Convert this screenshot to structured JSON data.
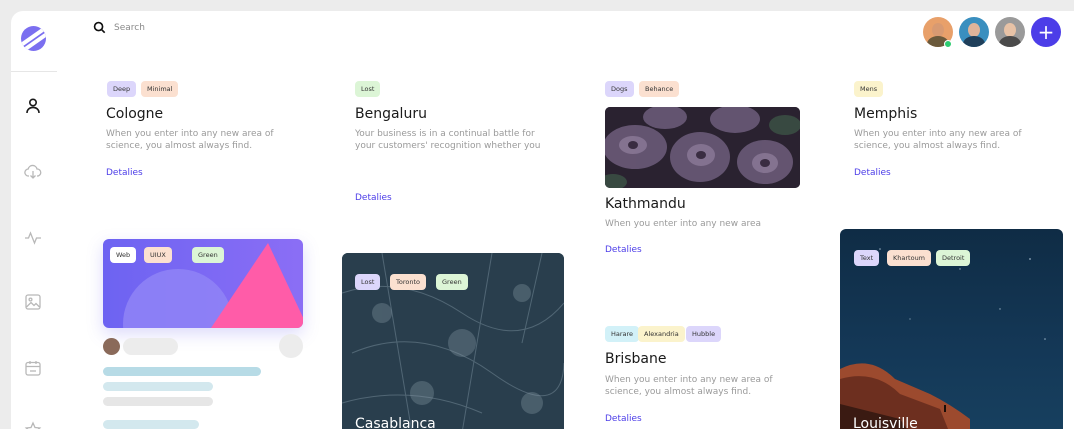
{
  "search": {
    "placeholder": "Search"
  },
  "sidebar": {
    "icons": [
      "logo-icon",
      "user-icon",
      "cloud-download-icon",
      "activity-icon",
      "image-icon",
      "calendar-icon",
      "star-icon"
    ]
  },
  "header": {
    "add_label": "+",
    "online_color": "#2ecc71",
    "accent_color": "#4c3de8"
  },
  "cards": {
    "cologne": {
      "tags": [
        "Deep",
        "Minimal"
      ],
      "title": "Cologne",
      "desc": "When you enter into any new area of science, you almost always find.",
      "link": "Detalies"
    },
    "bengaluru": {
      "tags": [
        "Lost"
      ],
      "title": "Bengaluru",
      "desc": "Your business is in a continual battle for your customers' recognition whether you",
      "link": "Detalies"
    },
    "kathmandu": {
      "tags": [
        "Dogs",
        "Behance"
      ],
      "title": "Kathmandu",
      "desc": "When you enter into any new area",
      "link": "Detalies"
    },
    "memphis": {
      "tags": [
        "Mens"
      ],
      "title": "Memphis",
      "desc": "When you enter into any new area of science, you almost always find.",
      "link": "Detalies"
    },
    "wireframe": {
      "tags": [
        "Web",
        "UIUX",
        "Green"
      ]
    },
    "casablanca": {
      "tags": [
        "Lost",
        "Toronto",
        "Green"
      ],
      "title": "Casablanca"
    },
    "brisbane": {
      "tags": [
        "Harare",
        "Alexandria",
        "Hubble"
      ],
      "title": "Brisbane",
      "desc": "When you enter into any new area of science, you almost always find.",
      "link": "Detalies"
    },
    "louisville": {
      "tags": [
        "Text",
        "Khartoum",
        "Detroit"
      ],
      "title": "Louisville"
    }
  }
}
